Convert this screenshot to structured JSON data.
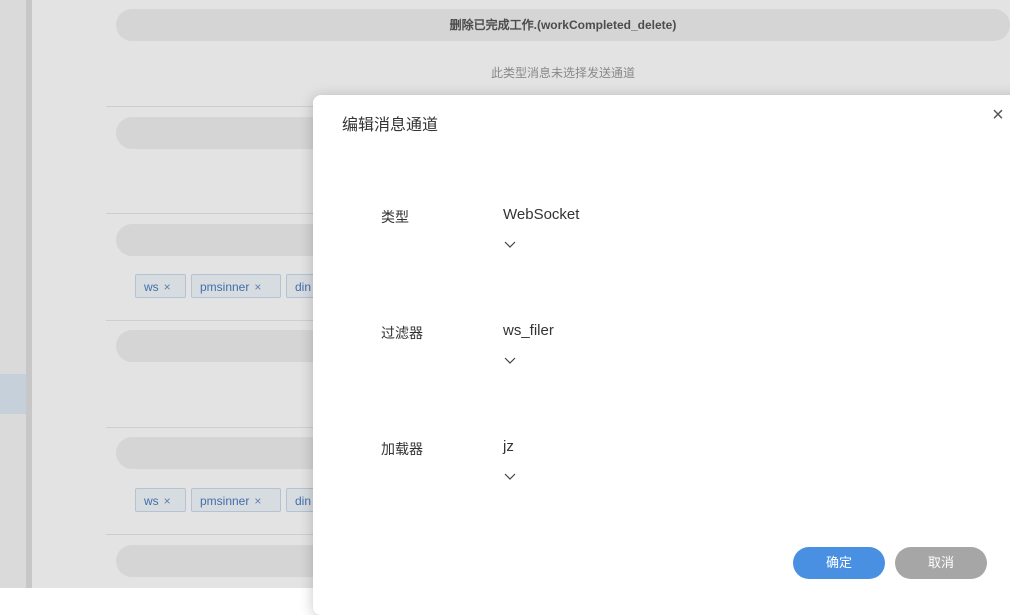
{
  "background": {
    "sections": [
      {
        "title": "删除已完成工作.(workCompleted_delete)",
        "hint": "此类型消息未选择发送通道"
      },
      {
        "title": "",
        "hint": ""
      },
      {
        "title": "",
        "tags": [
          "ws",
          "pmsinner",
          "din"
        ]
      },
      {
        "title": "",
        "hint": ""
      },
      {
        "title": "",
        "tags": [
          "ws",
          "pmsinner",
          "din"
        ]
      },
      {
        "title": ""
      }
    ],
    "close_glyph": "×"
  },
  "dialog": {
    "title": "编辑消息通道",
    "close_glyph": "×",
    "fields": [
      {
        "label": "类型",
        "value": "WebSocket"
      },
      {
        "label": "过滤器",
        "value": "ws_filer"
      },
      {
        "label": "加载器",
        "value": "jz"
      }
    ],
    "chevron_icon": "chevron-down-icon",
    "confirm_label": "确定",
    "cancel_label": "取消",
    "colors": {
      "confirm": "#4a90e2",
      "cancel": "#a6a6a6",
      "tag_text": "#4a7bbd"
    }
  }
}
